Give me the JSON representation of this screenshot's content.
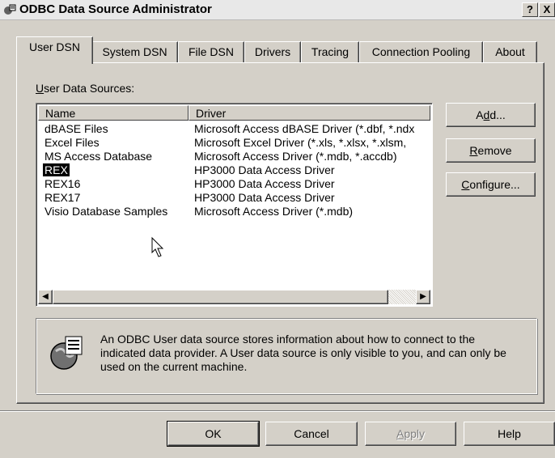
{
  "window": {
    "title": "ODBC Data Source Administrator",
    "help_button": "?",
    "close_button": "X",
    "icon": "odbc-admin-icon"
  },
  "tabs": [
    {
      "label": "User DSN",
      "active": true
    },
    {
      "label": "System DSN",
      "active": false
    },
    {
      "label": "File DSN",
      "active": false
    },
    {
      "label": "Drivers",
      "active": false
    },
    {
      "label": "Tracing",
      "active": false
    },
    {
      "label": "Connection Pooling",
      "active": false
    },
    {
      "label": "About",
      "active": false
    }
  ],
  "user_dsn": {
    "list_label_u": "U",
    "list_label_rest": "ser Data Sources:",
    "columns": [
      "Name",
      "Driver"
    ],
    "rows": [
      {
        "name": "dBASE Files",
        "driver": "Microsoft Access dBASE Driver (*.dbf, *.ndx"
      },
      {
        "name": "Excel Files",
        "driver": "Microsoft Excel Driver (*.xls, *.xlsx, *.xlsm,"
      },
      {
        "name": "MS Access Database",
        "driver": "Microsoft Access Driver (*.mdb, *.accdb)"
      },
      {
        "name": "REX",
        "driver": "HP3000 Data Access Driver",
        "selected": true
      },
      {
        "name": "REX16",
        "driver": "HP3000 Data Access Driver"
      },
      {
        "name": "REX17",
        "driver": "HP3000 Data Access Driver"
      },
      {
        "name": "Visio Database Samples",
        "driver": "Microsoft Access Driver (*.mdb)"
      }
    ],
    "buttons": {
      "add_pre": "A",
      "add_u": "d",
      "add_post": "d...",
      "remove_u": "R",
      "remove_post": "emove",
      "configure_u": "C",
      "configure_post": "onfigure..."
    },
    "info_text": "An ODBC User data source stores information about how to connect to the indicated data provider.   A User data source is only visible to you, and can only be used on the current machine."
  },
  "footer": {
    "ok": "OK",
    "cancel": "Cancel",
    "apply_u": "A",
    "apply_post": "pply",
    "help": "Help"
  }
}
